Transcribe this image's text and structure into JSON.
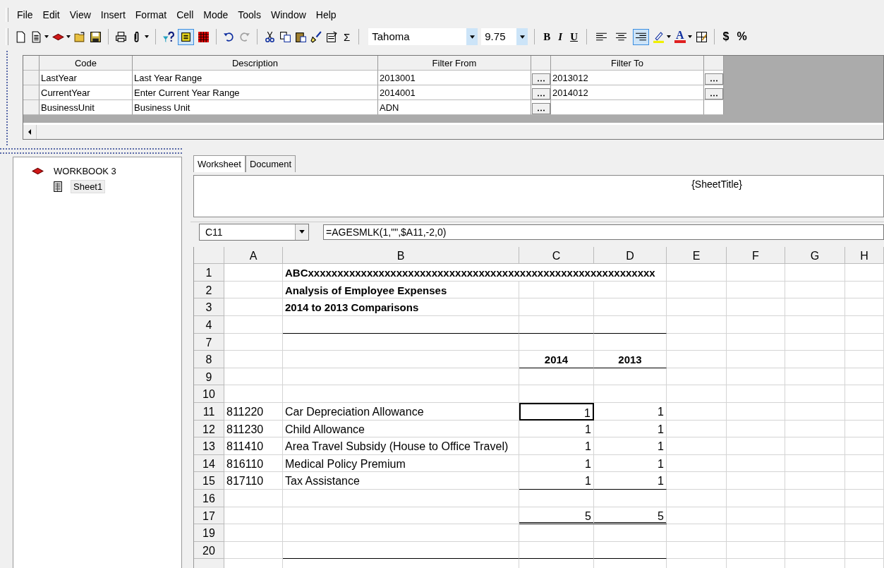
{
  "menu": [
    "File",
    "Edit",
    "View",
    "Insert",
    "Format",
    "Cell",
    "Mode",
    "Tools",
    "Window",
    "Help"
  ],
  "toolbar": {
    "gridlines_pressed": true,
    "redo_disabled": true,
    "sum": "Σ",
    "font": "Tahoma",
    "size": "9.75",
    "styles": [
      {
        "label": "B",
        "kind": "bold"
      },
      {
        "label": "I",
        "kind": "italic"
      },
      {
        "label": "U",
        "kind": "underline"
      }
    ],
    "align": [
      {
        "kind": "left",
        "selected": false
      },
      {
        "kind": "center",
        "selected": false
      },
      {
        "kind": "right",
        "selected": true
      }
    ],
    "font_color": "A",
    "currency": "$",
    "percent": "%"
  },
  "filters": {
    "columns": [
      "Code",
      "Description",
      "Filter From",
      "Filter To"
    ],
    "rows": [
      {
        "code": "LastYear",
        "description": "Last Year Range",
        "from": "2013001",
        "to": "2013012",
        "to_button": true
      },
      {
        "code": "CurrentYear",
        "description": "Enter Current Year Range",
        "from": "2014001",
        "to": "2014012",
        "to_button": true
      },
      {
        "code": "BusinessUnit",
        "description": "Business Unit",
        "from": "ADN",
        "to_button": false
      }
    ]
  },
  "tree": [
    {
      "label": "WORKBOOK 3",
      "children": [
        {
          "label": "Sheet1",
          "selected": true
        }
      ]
    }
  ],
  "tabs": [
    {
      "label": "Worksheet",
      "selected": true
    },
    {
      "label": "Document",
      "selected": false
    }
  ],
  "sheet_title": "{SheetTitle}",
  "formula_bar": {
    "cell": "C11",
    "formula": "=AGESMLK(1,\"\",$A11,-2,0)"
  },
  "sheet": {
    "columns": [
      "A",
      "B",
      "C",
      "D",
      "E",
      "F",
      "G",
      "H"
    ],
    "rows": [
      {
        "label": "1",
        "bold": true,
        "b": "ABCxxxxxxxxxxxxxxxxxxxxxxxxxxxxxxxxxxxxxxxxxxxxxxxxxxxxxxxxxxx"
      },
      {
        "label": "2",
        "bold": true,
        "b": "Analysis of Employee Expenses"
      },
      {
        "label": "3",
        "bold": true,
        "b": "2014 to 2013 Comparisons"
      },
      {
        "label": "4",
        "line_b": true,
        "line_c": true,
        "line_d": true
      },
      {
        "label": "7"
      },
      {
        "label": "8",
        "bold": true,
        "c": "2014",
        "d": "2013",
        "line_c": true,
        "line_d": true
      },
      {
        "label": "9"
      },
      {
        "label": "10"
      },
      {
        "label": "11",
        "a": "811220",
        "b": "Car Depreciation Allowance",
        "c": "1",
        "d": "1",
        "c_selected": true
      },
      {
        "label": "12",
        "a": "811230",
        "b": "Child Allowance",
        "c": "1",
        "d": "1"
      },
      {
        "label": "13",
        "a": "811410",
        "b": "Area Travel Subsidy (House to Office Travel)",
        "c": "1",
        "d": "1"
      },
      {
        "label": "14",
        "a": "816110",
        "b": "Medical Policy Premium",
        "c": "1",
        "d": "1"
      },
      {
        "label": "15",
        "a": "817110",
        "b": "Tax Assistance",
        "c": "1",
        "d": "1",
        "line_c": true,
        "line_d": true
      },
      {
        "label": "16"
      },
      {
        "label": "17",
        "c": "5",
        "d": "5",
        "line_c": true,
        "line_d": true,
        "double": true
      },
      {
        "label": "19"
      },
      {
        "label": "20",
        "line_b": true,
        "line_c": true,
        "line_d": true
      }
    ]
  }
}
